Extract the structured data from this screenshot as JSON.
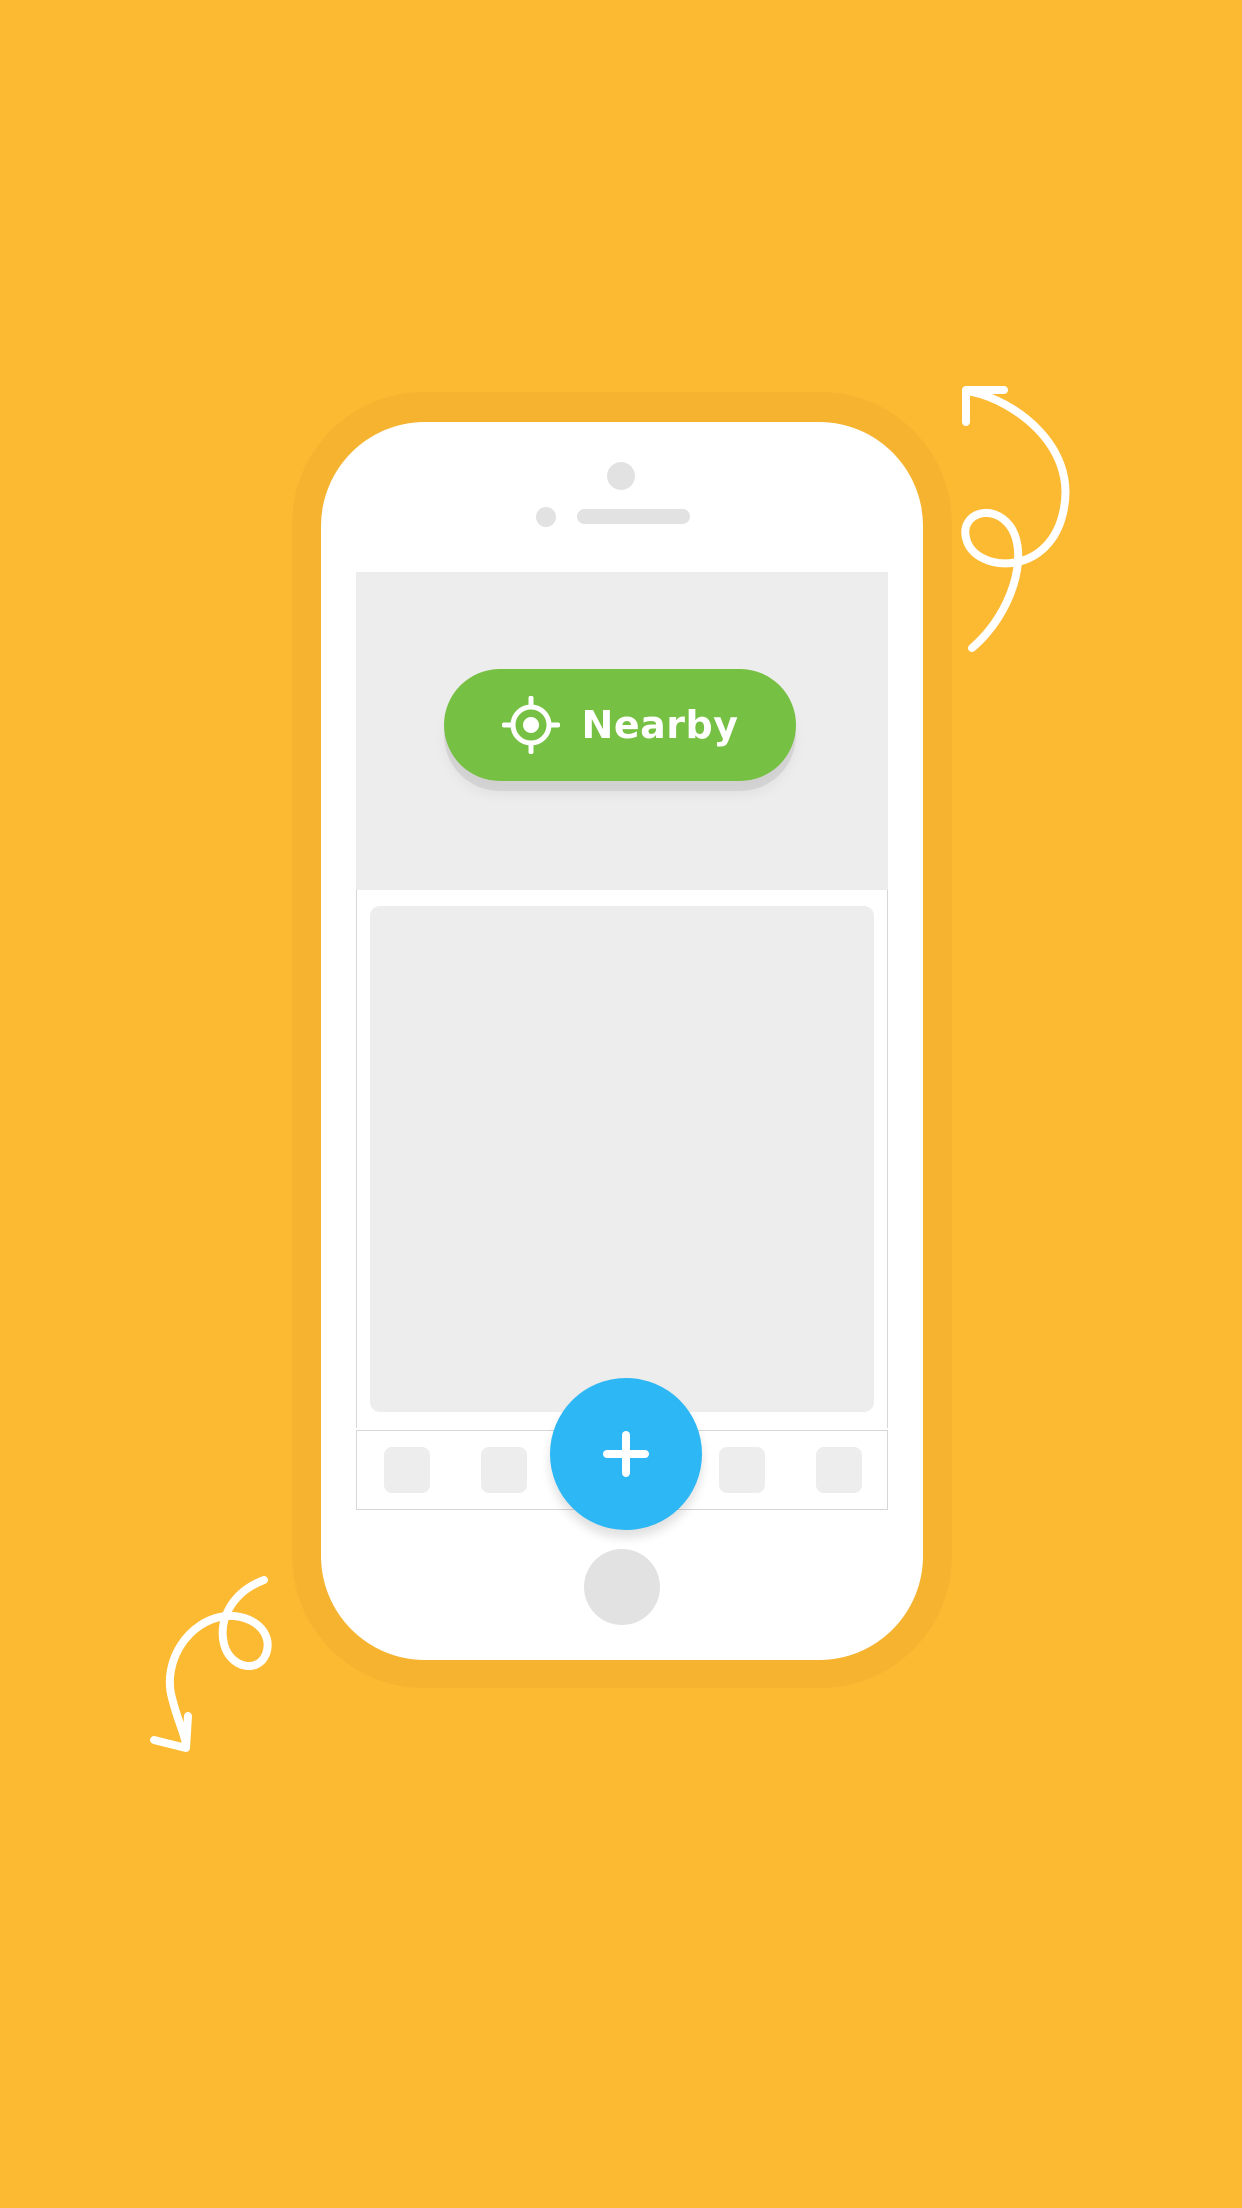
{
  "background_color": "#FCB932",
  "nearby_button": {
    "label": "Nearby",
    "icon": "crosshair-target-icon",
    "color": "#76C043"
  },
  "fab": {
    "icon": "plus-icon",
    "color": "#2DB7F5"
  },
  "tab_bar": {
    "item_count": 5
  },
  "decorations": {
    "top_right": "curly-arrow-up-icon",
    "bottom_left": "curly-arrow-down-icon"
  }
}
